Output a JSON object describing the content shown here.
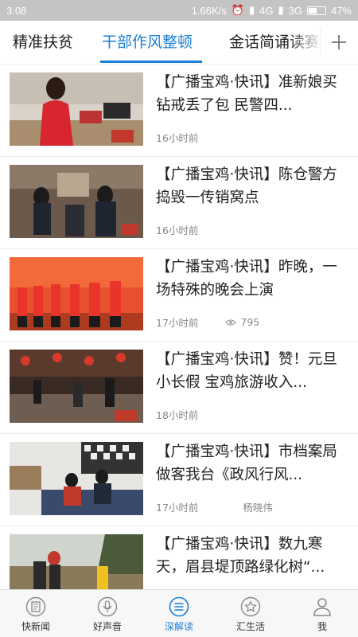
{
  "status_bar": {
    "time": "3:08",
    "indicators": "1.66K/s",
    "network_1": "4G",
    "network_2": "3G",
    "battery": "47%"
  },
  "tabs": [
    {
      "label": "精准扶贫",
      "active": false
    },
    {
      "label": "干部作风整顿",
      "active": true
    },
    {
      "label": "金话简诵读赛",
      "active": false
    }
  ],
  "add_tab_icon": "plus-icon",
  "news": [
    {
      "title": "【广播宝鸡·快讯】准新娘买钻戒丢了包 民警四...",
      "time": "16小时前",
      "views": "",
      "author": ""
    },
    {
      "title": "【广播宝鸡·快讯】陈仓警方捣毁一传销窝点",
      "time": "16小时前",
      "views": "",
      "author": ""
    },
    {
      "title": "【广播宝鸡·快讯】昨晚，一场特殊的晚会上演",
      "time": "17小时前",
      "views": "795",
      "author": ""
    },
    {
      "title": "【广播宝鸡·快讯】赞！元旦小长假 宝鸡旅游收入...",
      "time": "18小时前",
      "views": "",
      "author": ""
    },
    {
      "title": "【广播宝鸡·快讯】市档案局做客我台《政风行风...",
      "time": "17小时前",
      "views": "",
      "author": "杨晓伟"
    },
    {
      "title": "【广播宝鸡·快讯】数九寒天，眉县堤顶路绿化树“...",
      "time": "",
      "views": "",
      "author": ""
    }
  ],
  "bottom_nav": [
    {
      "label": "快新闻",
      "icon": "newspaper-icon",
      "active": false
    },
    {
      "label": "好声音",
      "icon": "microphone-icon",
      "active": false
    },
    {
      "label": "深解读",
      "icon": "menu-lines-icon",
      "active": true
    },
    {
      "label": "汇生活",
      "icon": "star-icon",
      "active": false
    },
    {
      "label": "我",
      "icon": "user-icon",
      "active": false
    }
  ],
  "colors": {
    "accent": "#1a7fd4",
    "status_bar_bg": "#c4c4c4",
    "nav_bg": "#f7f7f7"
  }
}
